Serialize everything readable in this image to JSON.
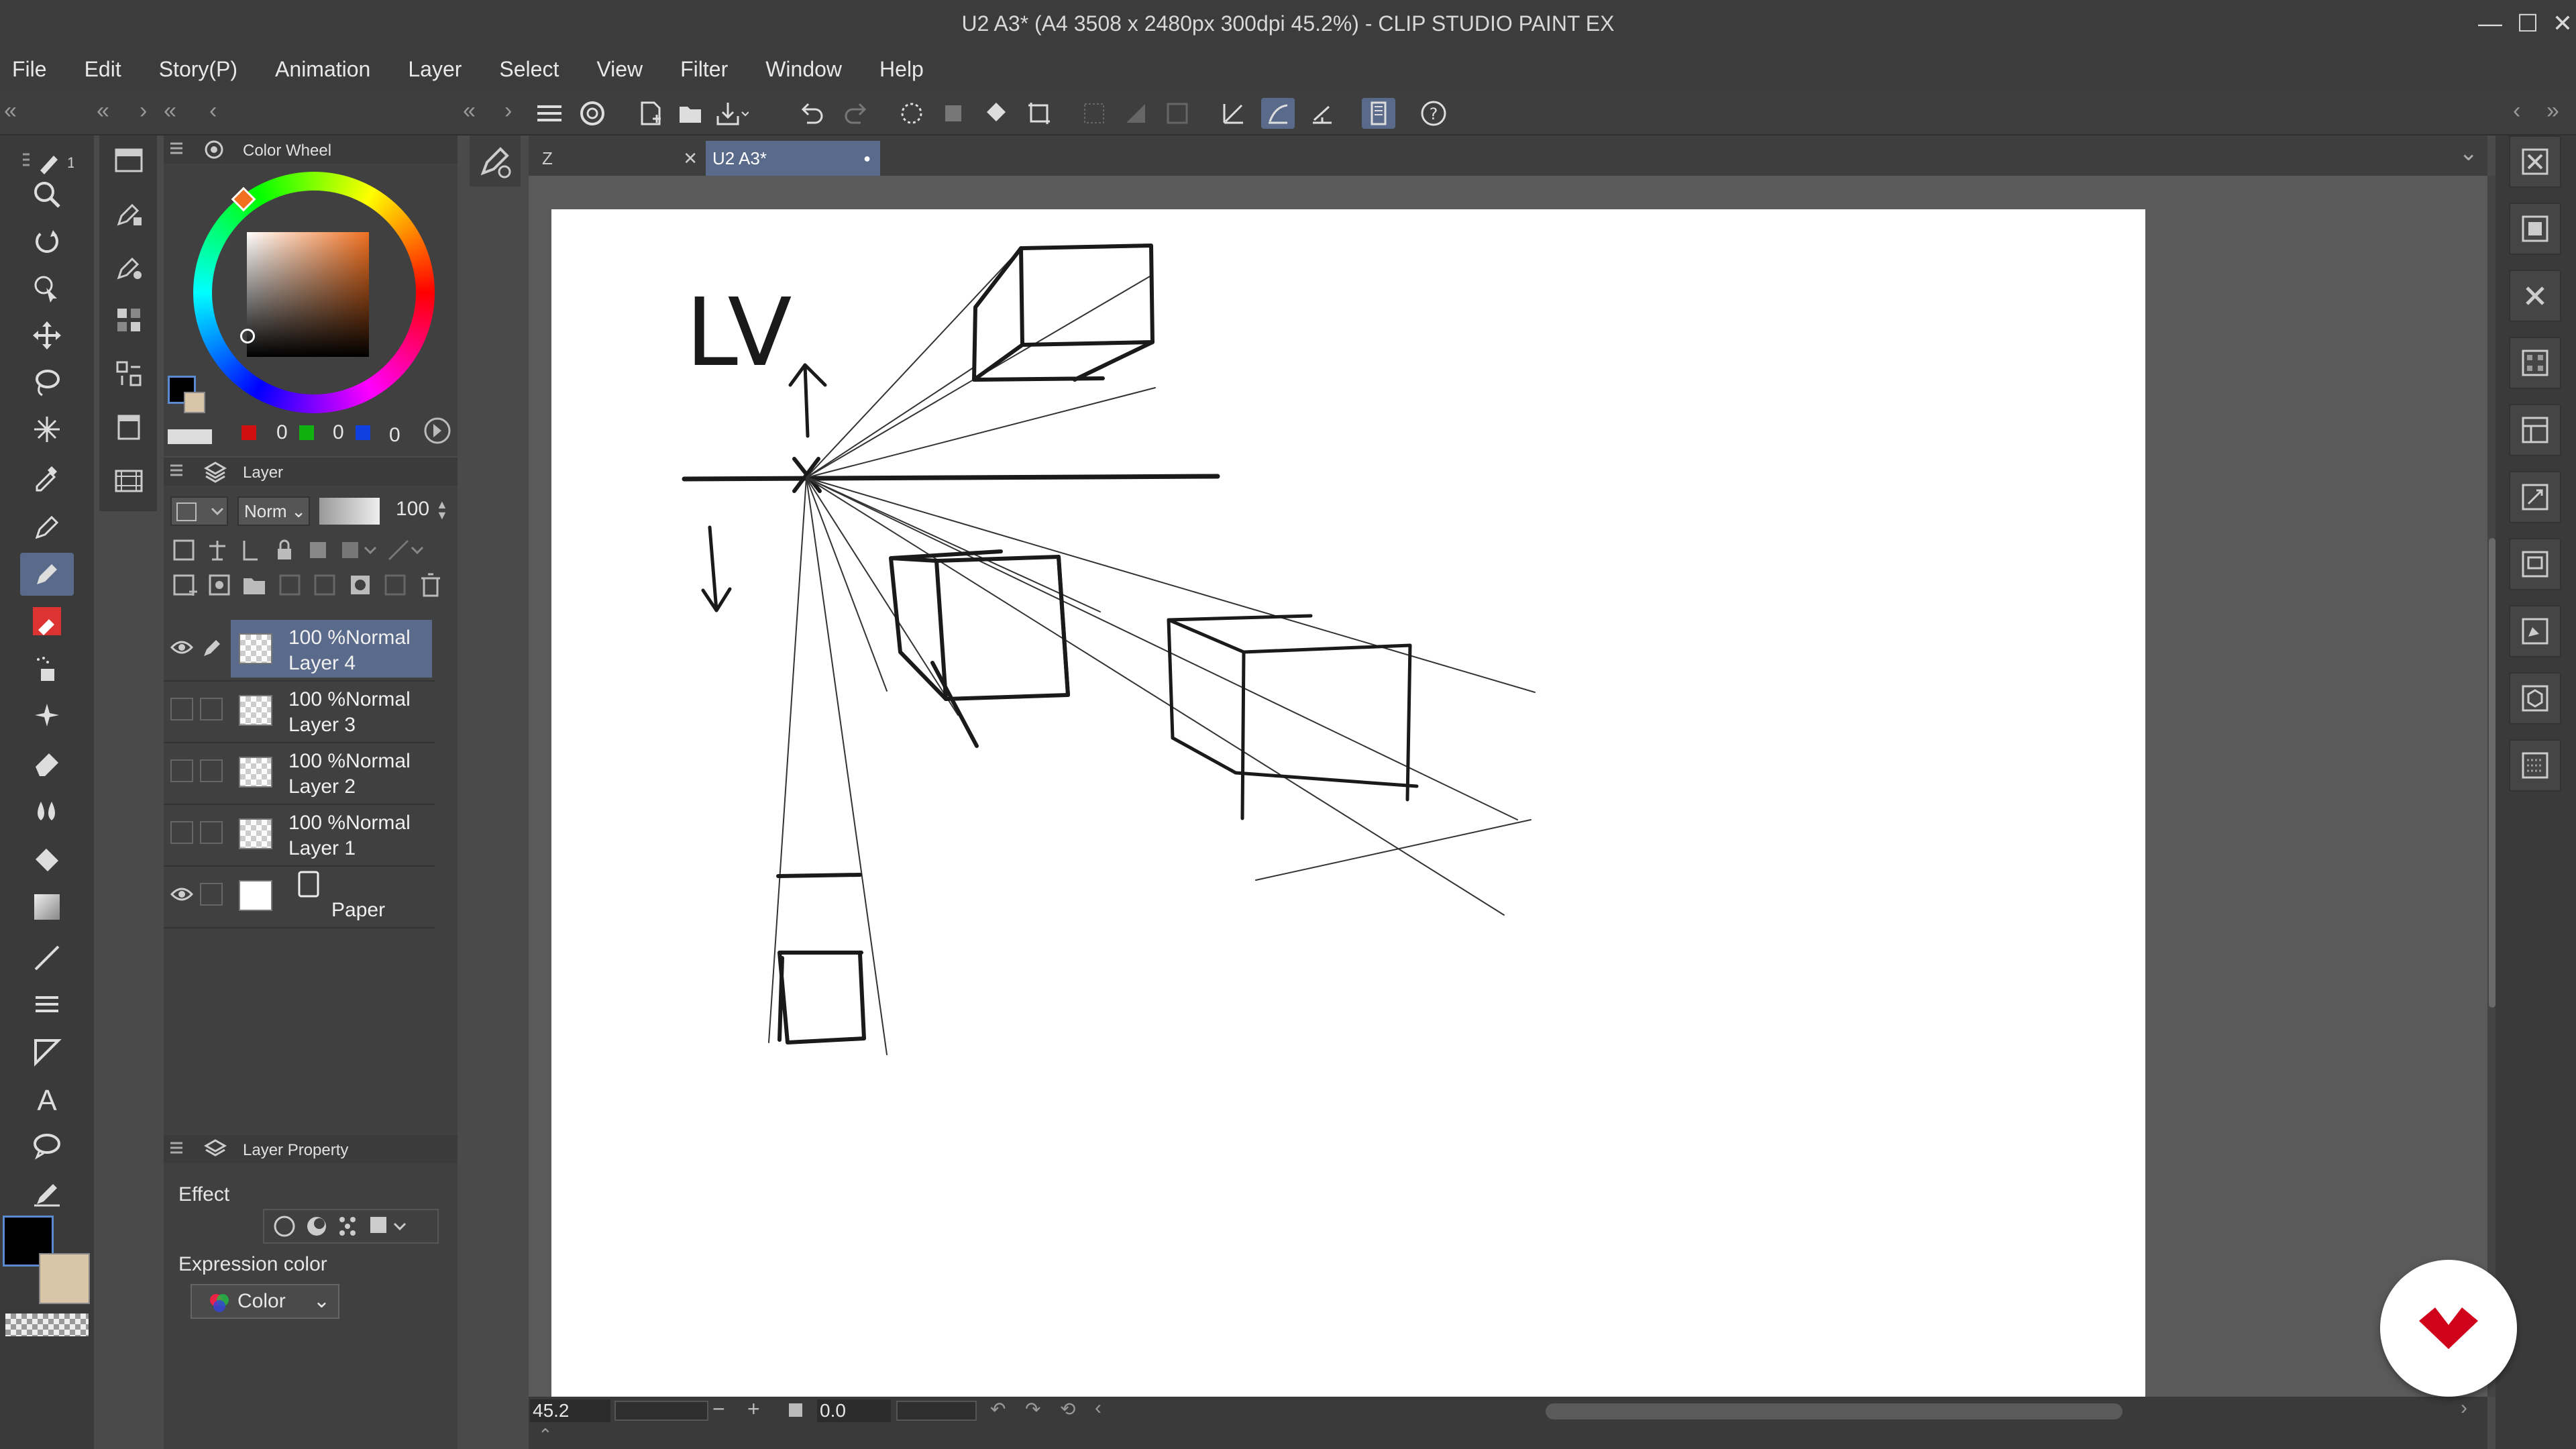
{
  "window": {
    "title": "U2 A3* (A4 3508 x 2480px 300dpi 45.2%)  - CLIP STUDIO PAINT EX",
    "controls": [
      "—",
      "☐",
      "✕"
    ]
  },
  "menu": [
    "File",
    "Edit",
    "Story(P)",
    "Animation",
    "Layer",
    "Select",
    "View",
    "Filter",
    "Window",
    "Help"
  ],
  "toolbar_counter": "1",
  "color_panel": {
    "title": "Color Wheel",
    "r": "0",
    "g": "0",
    "b": "0"
  },
  "layer_panel": {
    "title": "Layer",
    "blend_mode": "Norm",
    "opacity": "100",
    "layers": [
      {
        "percent": "100 %",
        "mode": "Normal",
        "name": "Layer 4",
        "selected": true,
        "visible": true
      },
      {
        "percent": "100 %",
        "mode": "Normal",
        "name": "Layer 3",
        "selected": false,
        "visible": false
      },
      {
        "percent": "100 %",
        "mode": "Normal",
        "name": "Layer 2",
        "selected": false,
        "visible": false
      },
      {
        "percent": "100 %",
        "mode": "Normal",
        "name": "Layer 1",
        "selected": false,
        "visible": false
      }
    ],
    "paper": {
      "name": "Paper",
      "visible": true
    }
  },
  "property_panel": {
    "title": "Layer Property",
    "effect_label": "Effect",
    "expression_color_label": "Expression color",
    "expression_color_value": "Color"
  },
  "tabs": [
    {
      "label": "Z",
      "close": "✕",
      "active": false
    },
    {
      "label": "U2 A3*",
      "close": "●",
      "active": true
    }
  ],
  "status": {
    "zoom": "45.2",
    "rotation": "0.0"
  },
  "canvas_text": {
    "label": "LV"
  },
  "colors": {
    "accent": "#5a6a8a",
    "fab_icon": "#d0021b",
    "main_color": "#000000",
    "sub_color": "#d9c6a8"
  }
}
